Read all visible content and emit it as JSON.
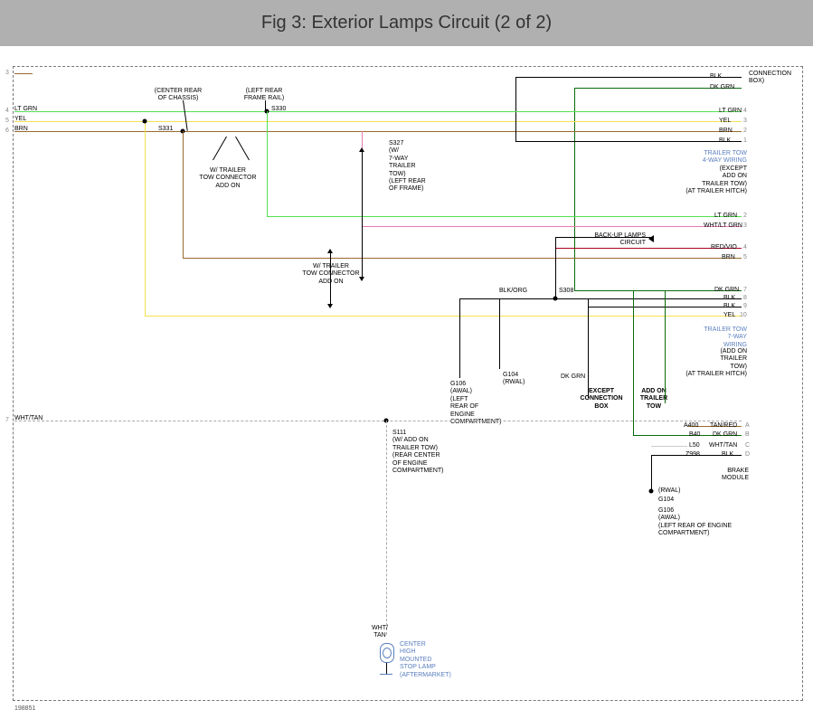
{
  "header": {
    "title": "Fig 3: Exterior Lamps Circuit (2 of 2)"
  },
  "doc_number": "198851",
  "left_pins": {
    "p3": "3",
    "p4": "4",
    "p5": "5",
    "p6": "6",
    "p7": "7",
    "lbl3": "",
    "lbl4": "LT GRN",
    "lbl5": "YEL",
    "lbl6": "BRN",
    "lbl7": "WHT/TAN"
  },
  "right_block1": {
    "title": "CONNECTION\nBOX)",
    "r1": "BLK",
    "r2": "DK GRN"
  },
  "right_block2": {
    "title": "TRAILER TOW\n4-WAY WIRING",
    "sub": "(EXCEPT\nADD ON\nTRAILER TOW)\n(AT TRAILER HITCH)",
    "p1": "BLK",
    "n1": "1",
    "p2": "BRN",
    "n2": "2",
    "p3": "YEL",
    "n3": "3",
    "p4": "LT GRN",
    "n4": "4"
  },
  "right_block3": {
    "backup": "BACK-UP LAMPS\nCIRCUIT",
    "p2": "LT GRN",
    "n2": "2",
    "p3": "WHT/LT GRN",
    "n3": "3",
    "p4": "RED/VIO",
    "n4": "4",
    "p5": "BRN",
    "n5": "5"
  },
  "right_block4": {
    "title": "TRAILER TOW\n7-WAY\nWIRING",
    "sub": "(ADD ON\nTRAILER\nTOW)\n(AT TRAILER HITCH)",
    "p7": "DK GRN",
    "n7": "7",
    "p8": "BLK",
    "n8": "8",
    "p9": "BLK",
    "n9": "9",
    "p10": "YEL",
    "n10": "10"
  },
  "right_block5": {
    "ra": "A400",
    "la": "TAN/RED",
    "na": "A",
    "rb": "B40",
    "lb": "DK GRN",
    "nb": "B",
    "rc": "L50",
    "lc": "WHT/TAN",
    "nc": "C",
    "rd": "Z998",
    "ld": "BLK",
    "nd": "D",
    "title": "BRAKE\nMODULE"
  },
  "notes": {
    "center_rear": "(CENTER REAR\nOF CHASSIS)",
    "left_rear_rail": "(LEFT REAR\nFRAME RAIL)",
    "s330": "S330",
    "s331": "S331",
    "s327": "S327\n(W/\n7-WAY\nTRAILER\nTOW)\n(LEFT REAR\nOF FRAME)",
    "tow_addon": "W/ TRAILER\nTOW CONNECTOR\nADD ON",
    "tow_addon2": "W/ TRAILER\nTOW CONNECTOR\nADD ON",
    "blkorg": "BLK/ORG",
    "s308": "S308",
    "g106": "G106\n(AWAL)\n(LEFT\nREAR OF\nENGINE\nCOMPARTMENT)",
    "g104": "G104\n(RWAL)",
    "dkgrn": "DK GRN",
    "except_box": "EXCEPT\nCONNECTION\nBOX",
    "addon_tow": "ADD ON\nTRAILER\nTOW",
    "rwal": "(RWAL)",
    "g104b": "G104",
    "g106b": "G106\n(AWAL)\n(LEFT REAR OF ENGINE\nCOMPARTMENT)",
    "s111": "S111\n(W/ ADD ON\nTRAILER TOW)\n(REAR CENTER\nOF ENGINE\nCOMPARTMENT)",
    "whttan": "WHT/\nTAN",
    "chmsl": "CENTER\nHIGH\nMOUNTED\nSTOP LAMP\n(AFTERMARKET)"
  }
}
